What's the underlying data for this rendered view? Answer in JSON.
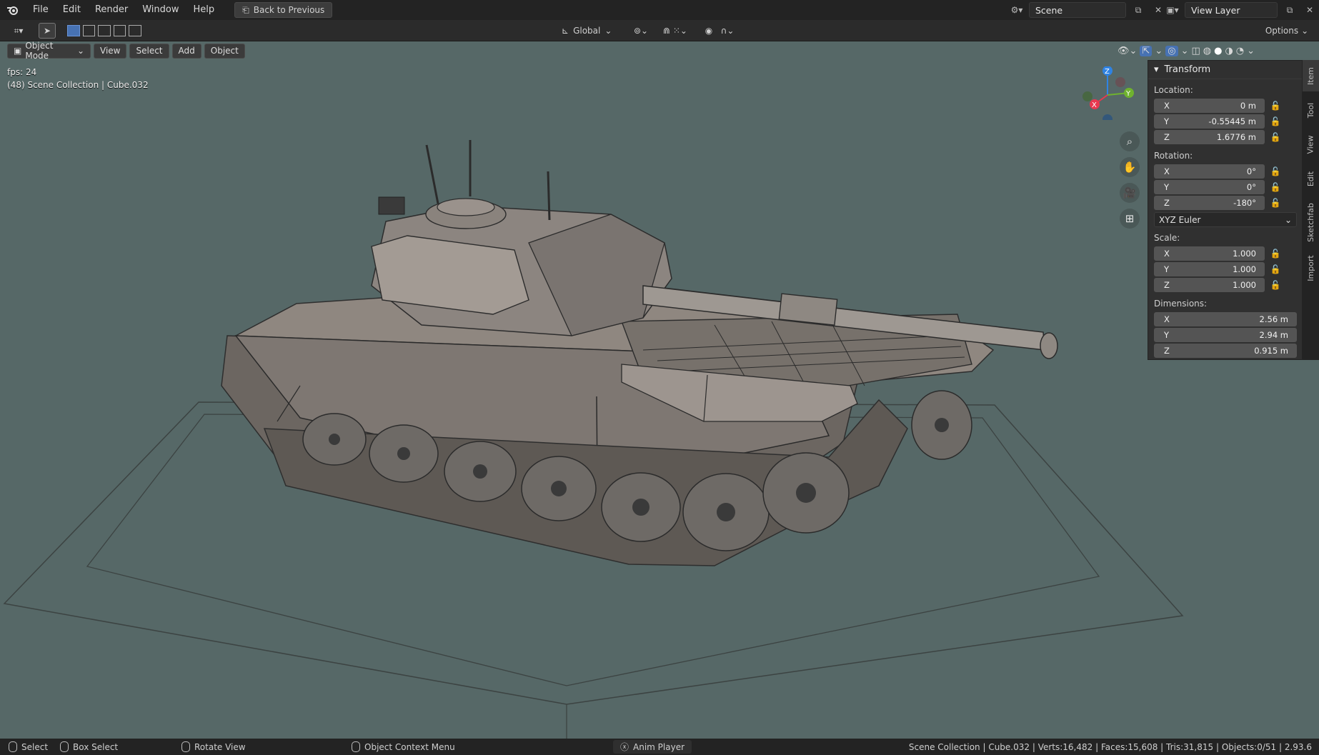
{
  "menu": {
    "items": [
      "File",
      "Edit",
      "Render",
      "Window",
      "Help"
    ],
    "back_label": "Back to Previous"
  },
  "scene": {
    "name": "Scene",
    "view_layer": "View Layer"
  },
  "toolbar": {
    "orientation": "Global",
    "options_label": "Options"
  },
  "modebar": {
    "mode": "Object Mode",
    "items": [
      "View",
      "Select",
      "Add",
      "Object"
    ]
  },
  "viewport": {
    "fps": "fps: 24",
    "object_info": "(48) Scene Collection | Cube.032",
    "background": "#566867",
    "gizmo": {
      "z": "Z",
      "y": "Y",
      "x": "X"
    }
  },
  "panel": {
    "title": "Transform",
    "location_label": "Location:",
    "location": [
      {
        "axis": "X",
        "value": "0 m"
      },
      {
        "axis": "Y",
        "value": "-0.55445 m"
      },
      {
        "axis": "Z",
        "value": "1.6776 m"
      }
    ],
    "rotation_label": "Rotation:",
    "rotation": [
      {
        "axis": "X",
        "value": "0°"
      },
      {
        "axis": "Y",
        "value": "0°"
      },
      {
        "axis": "Z",
        "value": "-180°"
      }
    ],
    "rotation_mode": "XYZ Euler",
    "scale_label": "Scale:",
    "scale": [
      {
        "axis": "X",
        "value": "1.000"
      },
      {
        "axis": "Y",
        "value": "1.000"
      },
      {
        "axis": "Z",
        "value": "1.000"
      }
    ],
    "dimensions_label": "Dimensions:",
    "dimensions": [
      {
        "axis": "X",
        "value": "2.56 m"
      },
      {
        "axis": "Y",
        "value": "2.94 m"
      },
      {
        "axis": "Z",
        "value": "0.915 m"
      }
    ]
  },
  "side_tabs": [
    "Item",
    "Tool",
    "View",
    "Edit",
    "Sketchfab",
    "Import"
  ],
  "status": {
    "select": "Select",
    "box_select": "Box Select",
    "rotate_view": "Rotate View",
    "context_menu": "Object Context Menu",
    "anim_player": "Anim Player",
    "stats": "Scene Collection | Cube.032 | Verts:16,482 | Faces:15,608 | Tris:31,815 | Objects:0/51 | 2.93.6"
  },
  "colors": {
    "accent_blue": "#4772b3",
    "axis_x": "#e8384f",
    "axis_y": "#6fb22f",
    "axis_z": "#2f83e3"
  }
}
